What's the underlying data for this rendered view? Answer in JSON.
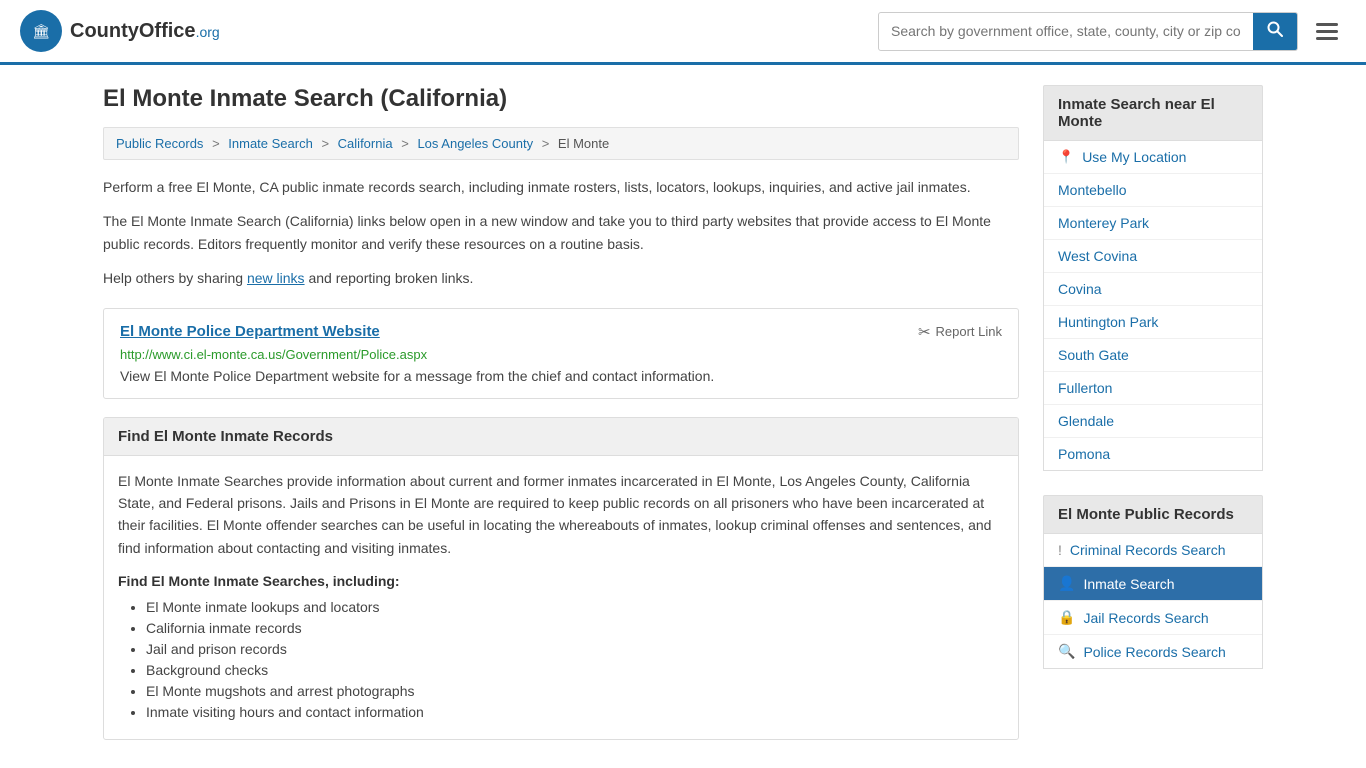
{
  "header": {
    "logo_text": "CountyOffice",
    "logo_org": ".org",
    "search_placeholder": "Search by government office, state, county, city or zip code",
    "search_value": ""
  },
  "page": {
    "title": "El Monte Inmate Search (California)"
  },
  "breadcrumb": {
    "items": [
      "Public Records",
      "Inmate Search",
      "California",
      "Los Angeles County",
      "El Monte"
    ]
  },
  "intro": {
    "p1": "Perform a free El Monte, CA public inmate records search, including inmate rosters, lists, locators, lookups, inquiries, and active jail inmates.",
    "p2": "The El Monte Inmate Search (California) links below open in a new window and take you to third party websites that provide access to El Monte public records. Editors frequently monitor and verify these resources on a routine basis.",
    "p3_pre": "Help others by sharing ",
    "p3_link": "new links",
    "p3_post": " and reporting broken links."
  },
  "link_card": {
    "title": "El Monte Police Department Website",
    "url": "http://www.ci.el-monte.ca.us/Government/Police.aspx",
    "description": "View El Monte Police Department website for a message from the chief and contact information.",
    "report_label": "Report Link"
  },
  "find_section": {
    "title": "Find El Monte Inmate Records",
    "body": "El Monte Inmate Searches provide information about current and former inmates incarcerated in El Monte, Los Angeles County, California State, and Federal prisons. Jails and Prisons in El Monte are required to keep public records on all prisoners who have been incarcerated at their facilities. El Monte offender searches can be useful in locating the whereabouts of inmates, lookup criminal offenses and sentences, and find information about contacting and visiting inmates.",
    "subheading": "Find El Monte Inmate Searches, including:",
    "bullets": [
      "El Monte inmate lookups and locators",
      "California inmate records",
      "Jail and prison records",
      "Background checks",
      "El Monte mugshots and arrest photographs",
      "Inmate visiting hours and contact information"
    ]
  },
  "sidebar": {
    "nearby_title": "Inmate Search near El Monte",
    "use_my_location": "Use My Location",
    "nearby_links": [
      "Montebello",
      "Monterey Park",
      "West Covina",
      "Covina",
      "Huntington Park",
      "South Gate",
      "Fullerton",
      "Glendale",
      "Pomona"
    ],
    "public_records_title": "El Monte Public Records",
    "public_records_links": [
      {
        "label": "Criminal Records Search",
        "icon": "!",
        "active": false
      },
      {
        "label": "Inmate Search",
        "icon": "👤",
        "active": true
      },
      {
        "label": "Jail Records Search",
        "icon": "🔒",
        "active": false
      },
      {
        "label": "Police Records Search",
        "icon": "🔍",
        "active": false
      }
    ]
  }
}
